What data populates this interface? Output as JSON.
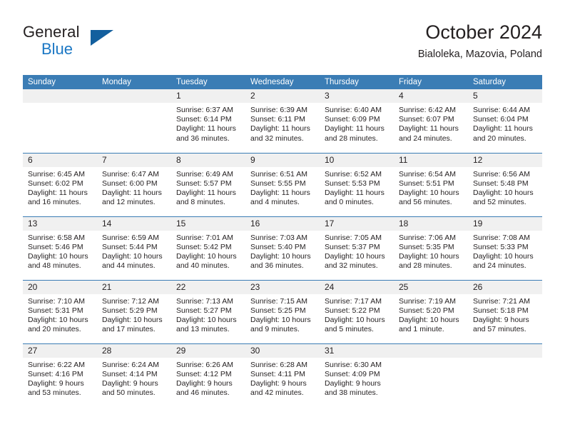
{
  "brand": {
    "name_part1": "General",
    "name_part2": "Blue",
    "triangle_color": "#135f9e",
    "blue_color": "#1b77c4"
  },
  "header": {
    "title": "October 2024",
    "subtitle": "Bialoleka, Mazovia, Poland"
  },
  "theme": {
    "header_bg": "#3b7db5",
    "daynum_bg": "#f0f0f0",
    "text": "#231f20"
  },
  "weekday_headers": [
    "Sunday",
    "Monday",
    "Tuesday",
    "Wednesday",
    "Thursday",
    "Friday",
    "Saturday"
  ],
  "labels": {
    "sunrise_prefix": "Sunrise:",
    "sunset_prefix": "Sunset:",
    "daylight_prefix": "Daylight:"
  },
  "weeks": [
    [
      {
        "day": "",
        "empty": true
      },
      {
        "day": "",
        "empty": true
      },
      {
        "day": "1",
        "sunrise": "Sunrise: 6:37 AM",
        "sunset": "Sunset: 6:14 PM",
        "daylight_1": "Daylight: 11 hours",
        "daylight_2": "and 36 minutes."
      },
      {
        "day": "2",
        "sunrise": "Sunrise: 6:39 AM",
        "sunset": "Sunset: 6:11 PM",
        "daylight_1": "Daylight: 11 hours",
        "daylight_2": "and 32 minutes."
      },
      {
        "day": "3",
        "sunrise": "Sunrise: 6:40 AM",
        "sunset": "Sunset: 6:09 PM",
        "daylight_1": "Daylight: 11 hours",
        "daylight_2": "and 28 minutes."
      },
      {
        "day": "4",
        "sunrise": "Sunrise: 6:42 AM",
        "sunset": "Sunset: 6:07 PM",
        "daylight_1": "Daylight: 11 hours",
        "daylight_2": "and 24 minutes."
      },
      {
        "day": "5",
        "sunrise": "Sunrise: 6:44 AM",
        "sunset": "Sunset: 6:04 PM",
        "daylight_1": "Daylight: 11 hours",
        "daylight_2": "and 20 minutes."
      }
    ],
    [
      {
        "day": "6",
        "sunrise": "Sunrise: 6:45 AM",
        "sunset": "Sunset: 6:02 PM",
        "daylight_1": "Daylight: 11 hours",
        "daylight_2": "and 16 minutes."
      },
      {
        "day": "7",
        "sunrise": "Sunrise: 6:47 AM",
        "sunset": "Sunset: 6:00 PM",
        "daylight_1": "Daylight: 11 hours",
        "daylight_2": "and 12 minutes."
      },
      {
        "day": "8",
        "sunrise": "Sunrise: 6:49 AM",
        "sunset": "Sunset: 5:57 PM",
        "daylight_1": "Daylight: 11 hours",
        "daylight_2": "and 8 minutes."
      },
      {
        "day": "9",
        "sunrise": "Sunrise: 6:51 AM",
        "sunset": "Sunset: 5:55 PM",
        "daylight_1": "Daylight: 11 hours",
        "daylight_2": "and 4 minutes."
      },
      {
        "day": "10",
        "sunrise": "Sunrise: 6:52 AM",
        "sunset": "Sunset: 5:53 PM",
        "daylight_1": "Daylight: 11 hours",
        "daylight_2": "and 0 minutes."
      },
      {
        "day": "11",
        "sunrise": "Sunrise: 6:54 AM",
        "sunset": "Sunset: 5:51 PM",
        "daylight_1": "Daylight: 10 hours",
        "daylight_2": "and 56 minutes."
      },
      {
        "day": "12",
        "sunrise": "Sunrise: 6:56 AM",
        "sunset": "Sunset: 5:48 PM",
        "daylight_1": "Daylight: 10 hours",
        "daylight_2": "and 52 minutes."
      }
    ],
    [
      {
        "day": "13",
        "sunrise": "Sunrise: 6:58 AM",
        "sunset": "Sunset: 5:46 PM",
        "daylight_1": "Daylight: 10 hours",
        "daylight_2": "and 48 minutes."
      },
      {
        "day": "14",
        "sunrise": "Sunrise: 6:59 AM",
        "sunset": "Sunset: 5:44 PM",
        "daylight_1": "Daylight: 10 hours",
        "daylight_2": "and 44 minutes."
      },
      {
        "day": "15",
        "sunrise": "Sunrise: 7:01 AM",
        "sunset": "Sunset: 5:42 PM",
        "daylight_1": "Daylight: 10 hours",
        "daylight_2": "and 40 minutes."
      },
      {
        "day": "16",
        "sunrise": "Sunrise: 7:03 AM",
        "sunset": "Sunset: 5:40 PM",
        "daylight_1": "Daylight: 10 hours",
        "daylight_2": "and 36 minutes."
      },
      {
        "day": "17",
        "sunrise": "Sunrise: 7:05 AM",
        "sunset": "Sunset: 5:37 PM",
        "daylight_1": "Daylight: 10 hours",
        "daylight_2": "and 32 minutes."
      },
      {
        "day": "18",
        "sunrise": "Sunrise: 7:06 AM",
        "sunset": "Sunset: 5:35 PM",
        "daylight_1": "Daylight: 10 hours",
        "daylight_2": "and 28 minutes."
      },
      {
        "day": "19",
        "sunrise": "Sunrise: 7:08 AM",
        "sunset": "Sunset: 5:33 PM",
        "daylight_1": "Daylight: 10 hours",
        "daylight_2": "and 24 minutes."
      }
    ],
    [
      {
        "day": "20",
        "sunrise": "Sunrise: 7:10 AM",
        "sunset": "Sunset: 5:31 PM",
        "daylight_1": "Daylight: 10 hours",
        "daylight_2": "and 20 minutes."
      },
      {
        "day": "21",
        "sunrise": "Sunrise: 7:12 AM",
        "sunset": "Sunset: 5:29 PM",
        "daylight_1": "Daylight: 10 hours",
        "daylight_2": "and 17 minutes."
      },
      {
        "day": "22",
        "sunrise": "Sunrise: 7:13 AM",
        "sunset": "Sunset: 5:27 PM",
        "daylight_1": "Daylight: 10 hours",
        "daylight_2": "and 13 minutes."
      },
      {
        "day": "23",
        "sunrise": "Sunrise: 7:15 AM",
        "sunset": "Sunset: 5:25 PM",
        "daylight_1": "Daylight: 10 hours",
        "daylight_2": "and 9 minutes."
      },
      {
        "day": "24",
        "sunrise": "Sunrise: 7:17 AM",
        "sunset": "Sunset: 5:22 PM",
        "daylight_1": "Daylight: 10 hours",
        "daylight_2": "and 5 minutes."
      },
      {
        "day": "25",
        "sunrise": "Sunrise: 7:19 AM",
        "sunset": "Sunset: 5:20 PM",
        "daylight_1": "Daylight: 10 hours",
        "daylight_2": "and 1 minute."
      },
      {
        "day": "26",
        "sunrise": "Sunrise: 7:21 AM",
        "sunset": "Sunset: 5:18 PM",
        "daylight_1": "Daylight: 9 hours",
        "daylight_2": "and 57 minutes."
      }
    ],
    [
      {
        "day": "27",
        "sunrise": "Sunrise: 6:22 AM",
        "sunset": "Sunset: 4:16 PM",
        "daylight_1": "Daylight: 9 hours",
        "daylight_2": "and 53 minutes."
      },
      {
        "day": "28",
        "sunrise": "Sunrise: 6:24 AM",
        "sunset": "Sunset: 4:14 PM",
        "daylight_1": "Daylight: 9 hours",
        "daylight_2": "and 50 minutes."
      },
      {
        "day": "29",
        "sunrise": "Sunrise: 6:26 AM",
        "sunset": "Sunset: 4:12 PM",
        "daylight_1": "Daylight: 9 hours",
        "daylight_2": "and 46 minutes."
      },
      {
        "day": "30",
        "sunrise": "Sunrise: 6:28 AM",
        "sunset": "Sunset: 4:11 PM",
        "daylight_1": "Daylight: 9 hours",
        "daylight_2": "and 42 minutes."
      },
      {
        "day": "31",
        "sunrise": "Sunrise: 6:30 AM",
        "sunset": "Sunset: 4:09 PM",
        "daylight_1": "Daylight: 9 hours",
        "daylight_2": "and 38 minutes."
      },
      {
        "day": "",
        "empty": true
      },
      {
        "day": "",
        "empty": true
      }
    ]
  ]
}
